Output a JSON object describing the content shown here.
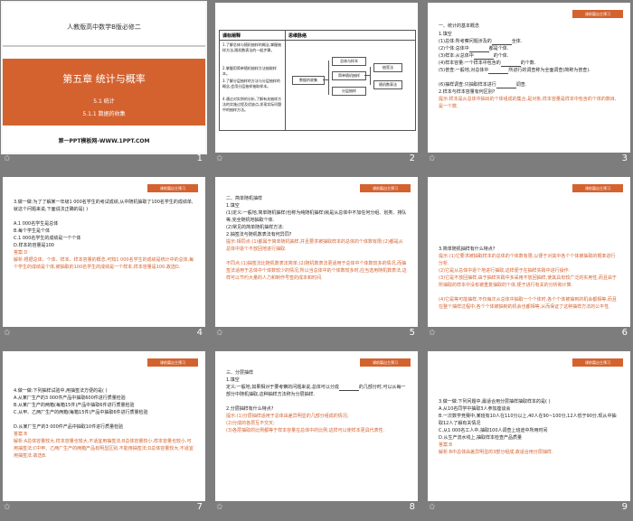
{
  "slides": [
    {
      "num": "1",
      "grade": "人教版高中数学B版必修二",
      "chapter": "第五章 统计与概率",
      "section": "5.1  统计",
      "subsection": "5.1.1 数据的收集",
      "footer": "第一PPT模板网-WWW.1PPT.COM"
    },
    {
      "num": "2",
      "col1": "课标阐释",
      "col2": "思维脉络",
      "goals": [
        "1.了解总体与随机抽样的概念,掌握抽样方法,随机数表法的一般步骤。",
        "2.掌握用简单随机抽样方法抽取样本。",
        "3.了解分层抽样的方法与分层抽样的概念,会用分层抽样抽取样本。",
        "4.通过对实例的分析,了解有关抽样方法的实施过程及优缺点,发现实际问题中的抽样方法。"
      ],
      "center": "数据的收集",
      "mid": [
        "总体与样本",
        "简单随机抽样",
        "分层抽样"
      ],
      "right": [
        "抽签法",
        "随机数表法"
      ]
    },
    {
      "num": "3",
      "tag": "课前篇自主预习",
      "title": "一、统计的基本概念",
      "lines": [
        "1.填空",
        "(1)总体:所考察问题涉及的",
        "全体.",
        "(2)个体:总体中",
        "都是个体.",
        "(3)样本:从总体中",
        "的个体.",
        "(4)样本容量:一个样本中包含的",
        "的个数.",
        "(5)普查:一般地,对总体中",
        "所进行的调查称为全面调查(简称为普查).",
        "(6)抽样调查:只抽取样本进行",
        "调查.",
        "2.样本与样本容量有何区别?",
        "提示:样本是从总体中抽出的个体组成的集合,是对象,样本容量是样本中包含的个体的数目,是一个数."
      ]
    },
    {
      "num": "4",
      "tag": "课前篇自主预习",
      "lines": [
        "3.做一做:为了了解某一年级1 000名学生的考试成绩,从中随机抽取了100名学生的成绩单,就这个问题来说,下面说法正确的是(  )",
        "A.1 000名学生是总体",
        "B.每个学生是个体",
        "C.1 000名学生的成绩是一个个体",
        "D.样本的容量是100",
        "答案:D",
        "解析:根据总体、个体、样本、样本容量的概念,可知1 000名学生的成绩是统计中的总体,每个学生的成绩是个体,被抽取的100名学生的成绩是一个样本,样本容量是100.故选D."
      ]
    },
    {
      "num": "5",
      "tag": "课前篇自主预习",
      "title": "二、简单随机抽样",
      "lines": [
        "1.填空",
        "(1)定义:一般地,简单随机抽样(也称为纯随机抽样)就是从总体中不加任何分组、划类、排队等,完全随机地抽取个体.",
        "(2)常见的简单随机抽样方法:",
        "2.抽签法与随机数表法有何异同?",
        "提示:相同点:(1)都属于简单随机抽样,并且要求被抽取样本的总体的个体数有限;(2)都是从总体中逐个不放回地进行抽取.",
        "不同点:(1)抽签法比随机数表法简单;(2)随机数表法更适用于总体中个体数较多的情况,而抽签法适用于总体中个体数较少的情况,所以当总体中的个体数较多时,应当选用随机数表法,这样可以节约大量的人力和制作号签的成本和时间."
      ]
    },
    {
      "num": "6",
      "tag": "课前篇自主预习",
      "lines": [
        "3.简单随机抽样有什么特点?",
        "提示:(1)它要求被抽取样本的总体的个体数有限,以便于对其中各个个体被抽取的概率进行分析.",
        "(2)它是从总体中逐个地进行抽取,这样便于在抽样实践中进行操作.",
        "(3)它是不放回抽样,由于抽样实践中多采用不放回抽样,使其具有较广泛的实用性,而且由于所抽取的样本中没有被重复抽取的个体,便于进行有关的分析和计算.",
        "(4)它是等可能抽样,不仅每次从总体中抽取一个个体时,各个个体被抽到的机会都相等,而且在整个抽样过程中,各个个体被抽到的机会也都相等,从而保证了这种抽样方法的公平性."
      ]
    },
    {
      "num": "7",
      "tag": "课前篇自主预习",
      "lines": [
        "4.做一做:下列抽样试验中,用抽签法方便的是(  )",
        "A.从某厂生产的3 000件产品中抽取600件进行质量检验",
        "B.从某厂生产的两箱(每箱15件)产品中抽取6件进行质量检验",
        "C.从甲、乙两厂生产的两箱(每箱15件)产品中抽取6件进行质量检验",
        "D.从某厂生产的3 000件产品中抽取10件进行质量检验",
        "答案:B",
        "解析:A总体容量较大,样本容量也较大,不适宜用抽签法;B总体容量较小,样本容量也较小,可用抽签法;C中甲、乙两厂生产的两箱产品有明显区别,不能用抽签法;D总体容量较大,不适宜用抽签法.故选B."
      ]
    },
    {
      "num": "8",
      "tag": "课前篇自主预习",
      "title": "三、分层抽样",
      "lines": [
        "1.填空",
        "定义:一般地,如果相对于要考察的问题来说,总体可以分成",
        "的几部分时,可以从每一部分中随机抽取,这种抽样方法称为分层抽样.",
        "2.分层抽样有什么特点?",
        "提示:(1)分层抽样适用于总体由差异明显的几部分组成的情况;",
        "(2)分成的各层互不交叉;",
        "(3)各层抽取的比例都等于样本容量在总体中的比例,这样可以使样本更具代表性."
      ]
    },
    {
      "num": "9",
      "tag": "课前篇自主预习",
      "lines": [
        "3.做一做:下列问题中,最适合用分层抽样抽取样本的是(  )",
        "A.从10名同学中抽取3人参加座谈会",
        "B.一次数学竞赛中,某班有10人在110分以上,40人在90~100分,12人低于90分,现从中抽取12人了解有关情况",
        "C.从1 000名工人中,抽取100人调查上班途中所用时间",
        "D.从生产流水线上,抽取样本检查产品质量",
        "答案:B",
        "解析:B中总体由差异明显的3部分组成,故适合用分层抽样."
      ]
    }
  ]
}
